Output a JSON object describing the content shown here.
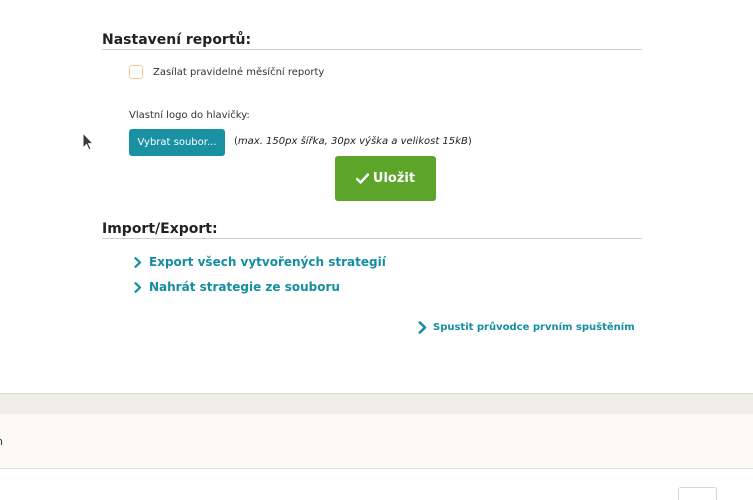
{
  "reports": {
    "title": "Nastavení reportů:",
    "monthly_checkbox_label": "Zasílat pravidelné měsíční reporty",
    "logo_label": "Vlastní logo do hlavičky:",
    "file_button_label": "Vybrat soubor...",
    "file_hint_open": "(",
    "file_hint": "max. 150px šířka, 30px výška a velikost 15kB",
    "file_hint_close": ")",
    "save_label": "Uložit"
  },
  "import_export": {
    "title": "Import/Export:",
    "links": [
      {
        "label": "Export všech vytvořených strategií"
      },
      {
        "label": "Nahrát strategie ze souboru"
      }
    ],
    "wizard_link": "Spustit průvodce prvním spuštěním"
  },
  "footer": {
    "fragment_text": "n"
  },
  "colors": {
    "accent": "#1a91a3",
    "link": "#148ea0",
    "save": "#5ca42a",
    "checkbox_border": "#f0c98a"
  }
}
